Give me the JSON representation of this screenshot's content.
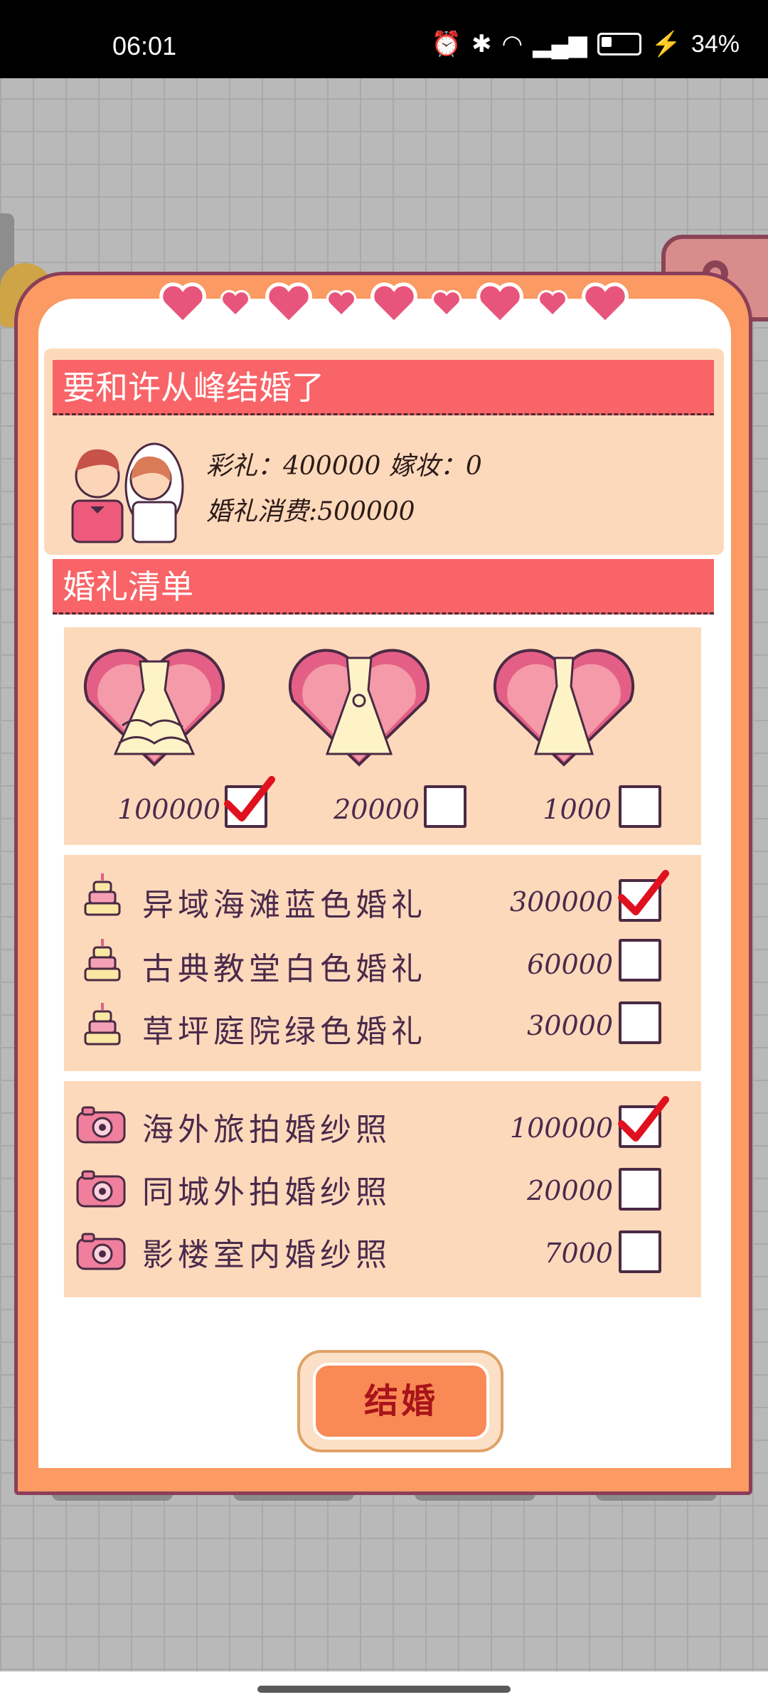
{
  "status_bar": {
    "time": "06:01",
    "battery": "34%"
  },
  "dialog": {
    "title": "要和许从峰结婚了",
    "bride_price_text": "彩礼：400000 嫁妆：0",
    "wedding_cost_text": "婚礼消费:500000",
    "checklist_title": "婚礼清单",
    "dresses": [
      {
        "price": "100000",
        "checked": true
      },
      {
        "price": "20000",
        "checked": false
      },
      {
        "price": "1000",
        "checked": false
      }
    ],
    "weddings": [
      {
        "label": "异域海滩蓝色婚礼",
        "price": "300000",
        "checked": true
      },
      {
        "label": "古典教堂白色婚礼",
        "price": "60000",
        "checked": false
      },
      {
        "label": "草坪庭院绿色婚礼",
        "price": "30000",
        "checked": false
      }
    ],
    "photos": [
      {
        "label": "海外旅拍婚纱照",
        "price": "100000",
        "checked": true
      },
      {
        "label": "同城外拍婚纱照",
        "price": "20000",
        "checked": false
      },
      {
        "label": "影楼室内婚纱照",
        "price": "7000",
        "checked": false
      }
    ],
    "marry_button": "结婚"
  },
  "icons": {
    "heart": "heart-icon",
    "cake": "wedding-cake-icon",
    "camera": "camera-icon",
    "check": "checkmark-icon"
  },
  "colors": {
    "accent_red": "#f86468",
    "panel_peach": "#fdd9bb",
    "dialog_orange": "#fb9a62",
    "text_purple": "#4a2a4c"
  }
}
